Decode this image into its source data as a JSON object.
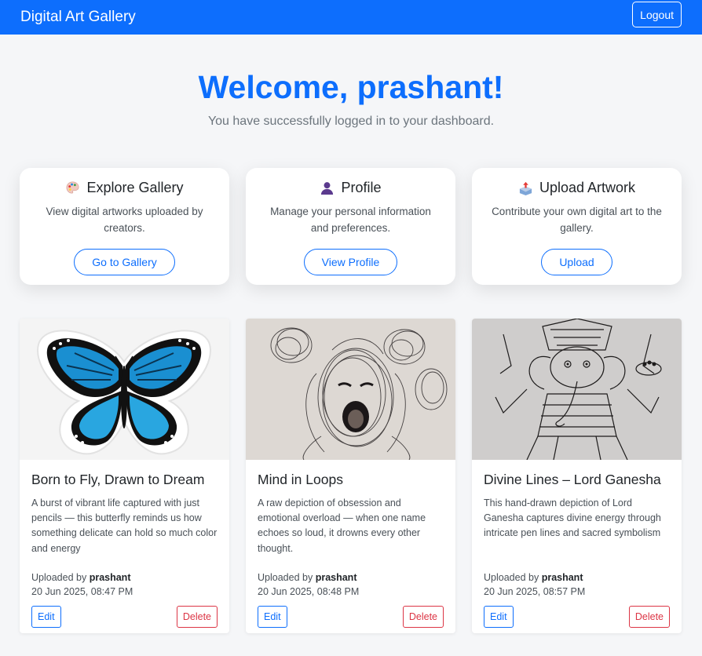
{
  "navbar": {
    "brand": "Digital Art Gallery",
    "logout_label": "Logout"
  },
  "hero": {
    "title": "Welcome, prashant!",
    "subtitle": "You have successfully logged in to your dashboard."
  },
  "features": [
    {
      "icon": "palette-icon",
      "title": "Explore Gallery",
      "description": "View digital artworks uploaded by creators.",
      "button": "Go to Gallery"
    },
    {
      "icon": "user-icon",
      "title": "Profile",
      "description": "Manage your personal information and preferences.",
      "button": "View Profile"
    },
    {
      "icon": "upload-box-icon",
      "title": "Upload Artwork",
      "description": "Contribute your own digital art to the gallery.",
      "button": "Upload"
    }
  ],
  "artworks": [
    {
      "image": "blue-butterfly-drawing",
      "title": "Born to Fly, Drawn to Dream",
      "description": "A burst of vibrant life captured with just pencils — this butterfly reminds us how something delicate can hold so much color and energy",
      "uploaded_prefix": "Uploaded by",
      "uploader": "prashant",
      "date": "20 Jun 2025, 08:47 PM",
      "edit_label": "Edit",
      "delete_label": "Delete"
    },
    {
      "image": "scribble-portrait-drawing",
      "title": "Mind in Loops",
      "description": "A raw depiction of obsession and emotional overload — when one name echoes so loud, it drowns every other thought.",
      "uploaded_prefix": "Uploaded by",
      "uploader": "prashant",
      "date": "20 Jun 2025, 08:48 PM",
      "edit_label": "Edit",
      "delete_label": "Delete"
    },
    {
      "image": "lord-ganesha-pen-drawing",
      "title": "Divine Lines – Lord Ganesha",
      "description": "This hand-drawn depiction of Lord Ganesha captures divine energy through intricate pen lines and sacred symbolism",
      "uploaded_prefix": "Uploaded by",
      "uploader": "prashant",
      "date": "20 Jun 2025, 08:57 PM",
      "edit_label": "Edit",
      "delete_label": "Delete"
    }
  ],
  "colors": {
    "primary": "#0d6efd",
    "danger": "#dc3545",
    "background": "#f5f6f8"
  }
}
